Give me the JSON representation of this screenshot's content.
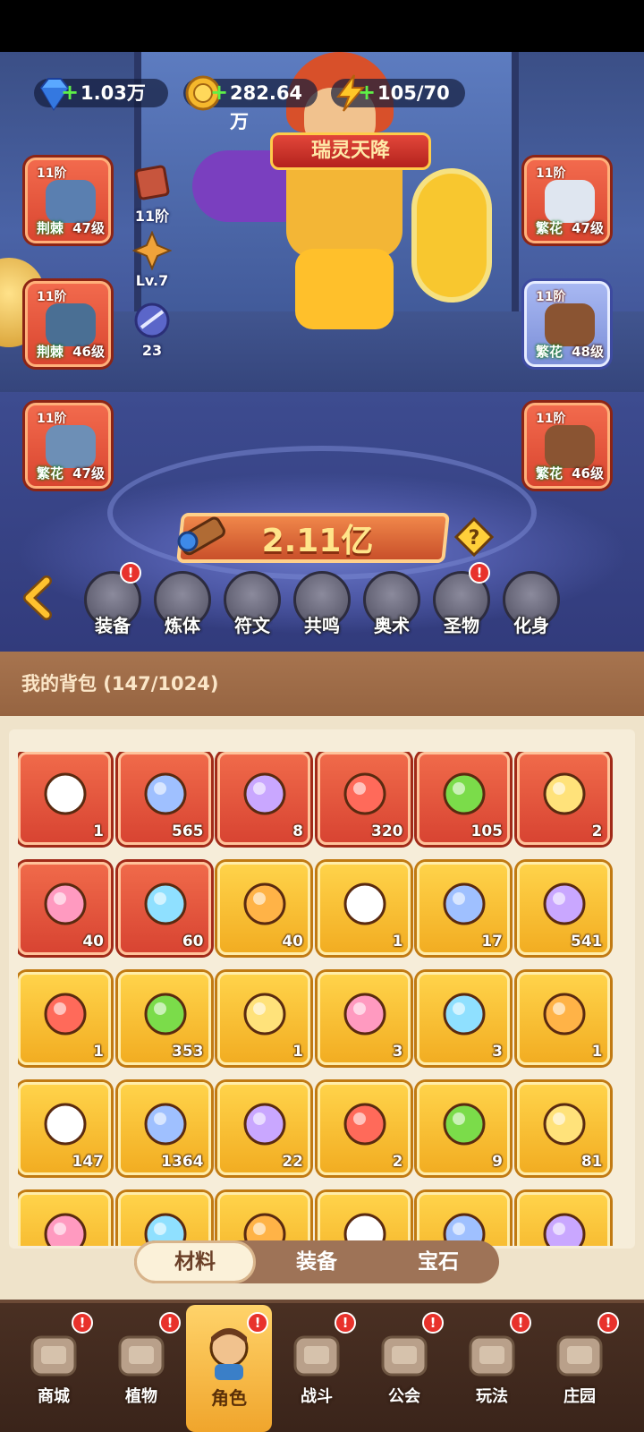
{
  "resources": {
    "gems": "1.03万",
    "gold": "282.64万",
    "energy": "105/70"
  },
  "event_banner": "瑞灵天降",
  "equipment": {
    "left": [
      {
        "tier": "11阶",
        "set": "荆棘",
        "level": "47级",
        "icon": "hat-icon"
      },
      {
        "tier": "11阶",
        "set": "荆棘",
        "level": "46级",
        "icon": "gloves-icon"
      },
      {
        "tier": "11阶",
        "set": "繁花",
        "level": "47级",
        "icon": "shorts-icon"
      }
    ],
    "right": [
      {
        "tier": "11阶",
        "set": "繁花",
        "level": "47级",
        "icon": "shirt-icon"
      },
      {
        "tier": "11阶",
        "set": "繁花",
        "level": "48级",
        "icon": "belt-icon"
      },
      {
        "tier": "11阶",
        "set": "繁花",
        "level": "46级",
        "icon": "boots-icon"
      }
    ]
  },
  "mini_badges": {
    "tome_tier": "11阶",
    "level": "Lv.7",
    "orb_count": "23"
  },
  "power": "2.11亿",
  "function_tabs": [
    {
      "label": "装备",
      "alert": "!"
    },
    {
      "label": "炼体",
      "alert": ""
    },
    {
      "label": "符文",
      "alert": ""
    },
    {
      "label": "共鸣",
      "alert": ""
    },
    {
      "label": "奥术",
      "alert": ""
    },
    {
      "label": "圣物",
      "alert": "!"
    },
    {
      "label": "化身",
      "alert": ""
    }
  ],
  "bag": {
    "title": "我的背包 (147/1024)",
    "items": [
      {
        "count": "1",
        "icon": "shuriken-icon",
        "rarity": "red"
      },
      {
        "count": "565",
        "icon": "blue-star-crystal-icon",
        "rarity": "red"
      },
      {
        "count": "8",
        "icon": "moon-crystal-icon",
        "rarity": "red"
      },
      {
        "count": "320",
        "icon": "red-potion-icon",
        "rarity": "red"
      },
      {
        "count": "105",
        "icon": "green-canister-icon",
        "rarity": "red"
      },
      {
        "count": "2",
        "icon": "green-vial-icon",
        "rarity": "red"
      },
      {
        "count": "40",
        "icon": "pink-star-flower-icon",
        "rarity": "red"
      },
      {
        "count": "60",
        "icon": "fire-fruit-icon",
        "rarity": "red"
      },
      {
        "count": "40",
        "icon": "gold-flask-icon",
        "rarity": "gold"
      },
      {
        "count": "1",
        "icon": "water-drop-icon",
        "rarity": "gold"
      },
      {
        "count": "17",
        "icon": "skull-scroll-icon",
        "rarity": "gold"
      },
      {
        "count": "541",
        "icon": "golden-key-icon",
        "rarity": "gold"
      },
      {
        "count": "1",
        "icon": "red-flame-leaf-icon",
        "rarity": "gold"
      },
      {
        "count": "353",
        "icon": "triangle-ingot-icon",
        "rarity": "gold"
      },
      {
        "count": "1",
        "icon": "amber-gem-icon",
        "rarity": "gold"
      },
      {
        "count": "3",
        "icon": "star-orb-icon",
        "rarity": "gold"
      },
      {
        "count": "3",
        "icon": "blue-mushroom-icon",
        "rarity": "gold"
      },
      {
        "count": "1",
        "icon": "golden-sphere-icon",
        "rarity": "gold"
      },
      {
        "count": "147",
        "icon": "yellow-rose-icon",
        "rarity": "gold"
      },
      {
        "count": "1364",
        "icon": "orange-potion-icon",
        "rarity": "gold"
      },
      {
        "count": "22",
        "icon": "gold-crystal-pile-icon",
        "rarity": "gold"
      },
      {
        "count": "2",
        "icon": "gold-ore-icon",
        "rarity": "gold"
      },
      {
        "count": "9",
        "icon": "red-flower-icon",
        "rarity": "gold"
      },
      {
        "count": "81",
        "icon": "flower-pot-icon",
        "rarity": "gold"
      },
      {
        "count": "",
        "icon": "green-chest-icon",
        "rarity": "gold"
      },
      {
        "count": "",
        "icon": "clay-pot-icon",
        "rarity": "gold"
      },
      {
        "count": "",
        "icon": "purple-book-icon",
        "rarity": "gold"
      },
      {
        "count": "",
        "icon": "stone-jar-icon",
        "rarity": "gold"
      },
      {
        "count": "",
        "icon": "duck-puzzle-icon",
        "rarity": "gold"
      },
      {
        "count": "",
        "icon": "red-ring-icon",
        "rarity": "gold"
      }
    ],
    "tabs": [
      "材料",
      "装备",
      "宝石"
    ],
    "active_tab": "材料"
  },
  "bottom_nav": [
    {
      "label": "商城",
      "alert": "!",
      "icon": "shop-icon"
    },
    {
      "label": "植物",
      "alert": "!",
      "icon": "plant-icon"
    },
    {
      "label": "角色",
      "alert": "!",
      "icon": "character-icon"
    },
    {
      "label": "战斗",
      "alert": "!",
      "icon": "battle-icon"
    },
    {
      "label": "公会",
      "alert": "!",
      "icon": "guild-icon"
    },
    {
      "label": "玩法",
      "alert": "!",
      "icon": "gameplay-icon"
    },
    {
      "label": "庄园",
      "alert": "!",
      "icon": "manor-icon"
    }
  ],
  "colors": {
    "red_rarity": "#e0503a",
    "gold_rarity": "#f5b72c",
    "alert": "#e8322c",
    "power_text": "#ffe58a"
  }
}
